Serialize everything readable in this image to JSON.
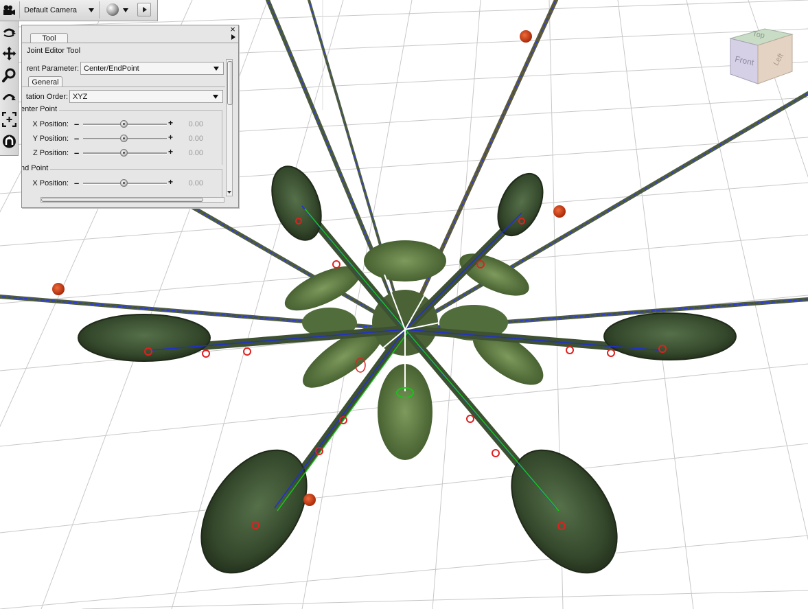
{
  "toolbar": {
    "camera_label": "Default Camera",
    "camera_icon": "movie-camera-icon",
    "shading_icon": "sphere-shading-icon",
    "play_icon": "play-icon"
  },
  "tools": [
    {
      "name": "orbit-icon"
    },
    {
      "name": "move-icon"
    },
    {
      "name": "zoom-icon"
    },
    {
      "name": "roll-icon"
    },
    {
      "name": "frame-icon"
    },
    {
      "name": "rotate-icon"
    }
  ],
  "panel": {
    "tab_label": "Tool",
    "close_label": "×",
    "tool_title": "Joint Editor Tool",
    "current_parameter_label": "rent Parameter:",
    "current_parameter_value": "Center/EndPoint",
    "subtab_label": "General",
    "rotation_order_label": "tation Order:",
    "rotation_order_value": "XYZ",
    "center_point_title": "enter Point",
    "end_point_title": "nd Point",
    "center_point": [
      {
        "label": "X Position:",
        "value": "0.00"
      },
      {
        "label": "Y Position:",
        "value": "0.00"
      },
      {
        "label": "Z Position:",
        "value": "0.00"
      }
    ],
    "end_point": [
      {
        "label": "X Position:",
        "value": "0.00"
      }
    ]
  },
  "view_cube": {
    "top_label": "Top",
    "front_label": "Front",
    "left_label": "Left"
  },
  "colors": {
    "grid_line": "#c9c9c9",
    "light_marker": "#c33a12",
    "creature_green": "#3f5a33",
    "bone_blue": "#1f2fd6",
    "bone_green": "#19c41b",
    "bone_red": "#e02020"
  }
}
